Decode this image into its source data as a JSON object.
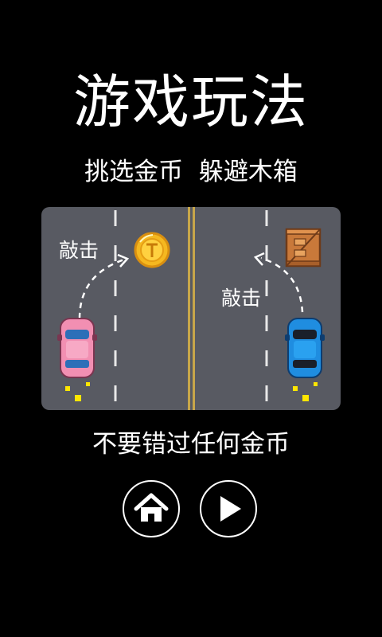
{
  "screen": {
    "title": "游戏玩法",
    "subtitle": "挑选金币  躲避木箱",
    "hit_left": "敲击",
    "hit_right": "敲击",
    "footer": "不要错过任何金币"
  },
  "buttons": {
    "home": {
      "icon": "home-icon"
    },
    "play": {
      "icon": "play-icon"
    }
  },
  "colors": {
    "background": "#000000",
    "road": "#585a62",
    "center_line": "#c7a64a",
    "coin": "#f5b820",
    "pink_car": "#f28fb2",
    "blue_car": "#1f8de0",
    "crate": "#c9793a",
    "spark": "#ffe600"
  }
}
